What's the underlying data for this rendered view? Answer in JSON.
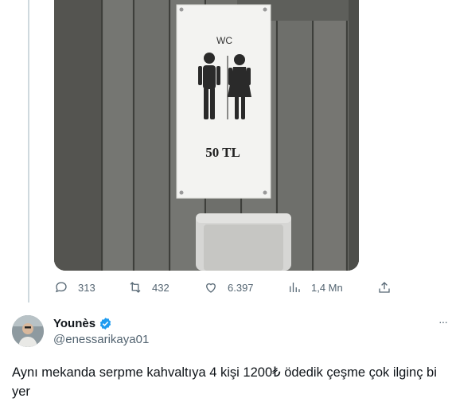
{
  "tweet_photo": {
    "sign_title": "WC",
    "sign_price": "50 TL"
  },
  "actions": {
    "replies": "313",
    "retweets": "432",
    "likes": "6.397",
    "views": "1,4 Mn"
  },
  "reply": {
    "display_name": "Younès",
    "handle": "@enessarikaya01",
    "more_label": "···",
    "text": "Aynı mekanda serpme kahvaltıya 4 kişi 1200₺ ödedik çeşme çok ilginç bi yer"
  },
  "icons": {
    "reply": "comment-icon",
    "retweet": "retweet-icon",
    "like": "heart-icon",
    "views": "bar-chart-icon",
    "share": "share-icon",
    "verified": "verified-badge-icon"
  },
  "colors": {
    "verified": "#1d9bf0",
    "muted": "#536471",
    "text": "#0f1419"
  }
}
